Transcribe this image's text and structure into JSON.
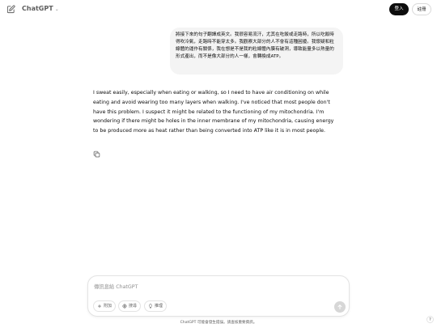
{
  "header": {
    "new_chat_icon": "pencil-square-icon",
    "title": "ChatGPT",
    "title_chevron": "⌄",
    "login_label": "登入",
    "signup_label": "註冊"
  },
  "conversation": {
    "user_message": "將接下來的句子翻譯成英文。我很容易流汗，尤其在吃飯或走路時，所以吃飯時得吹冷氣，走路時不能穿太多。我觀察大部分的人不會有這種困擾。我懷疑和粒線體的運作有關係，我在想是不是我的粒線體內膜有破洞，導致能量多以熱量的形式產出，而不是像大部分的人一樣，會轉換成ATP。",
    "assistant_message": "I sweat easily, especially when eating or walking, so I need to have air conditioning on while eating and avoid wearing too many layers when walking. I've noticed that most people don't have this problem. I suspect it might be related to the functioning of my mitochondria. I'm wondering if there might be holes in the inner membrane of my mitochondria, causing energy to be produced more as heat rather than being converted into ATP like it is in most people.",
    "copy_icon": "copy-icon"
  },
  "composer": {
    "placeholder": "傳訊息給 ChatGPT",
    "attach_label": "附加",
    "search_label": "搜尋",
    "reason_label": "推理",
    "attach_icon": "plus-icon",
    "search_icon": "globe-icon",
    "reason_icon": "lightbulb-icon",
    "send_icon": "arrow-up-icon"
  },
  "footer": {
    "disclaimer": "ChatGPT 可能會發生錯誤。請查核重要資訊。",
    "help_label": "?"
  },
  "colors": {
    "background": "#ffffff",
    "user_bubble": "#f4f4f4",
    "login_button": "#0d0d0d",
    "send_button_disabled": "#d7d7d7",
    "muted_text": "#5d5d5d"
  }
}
